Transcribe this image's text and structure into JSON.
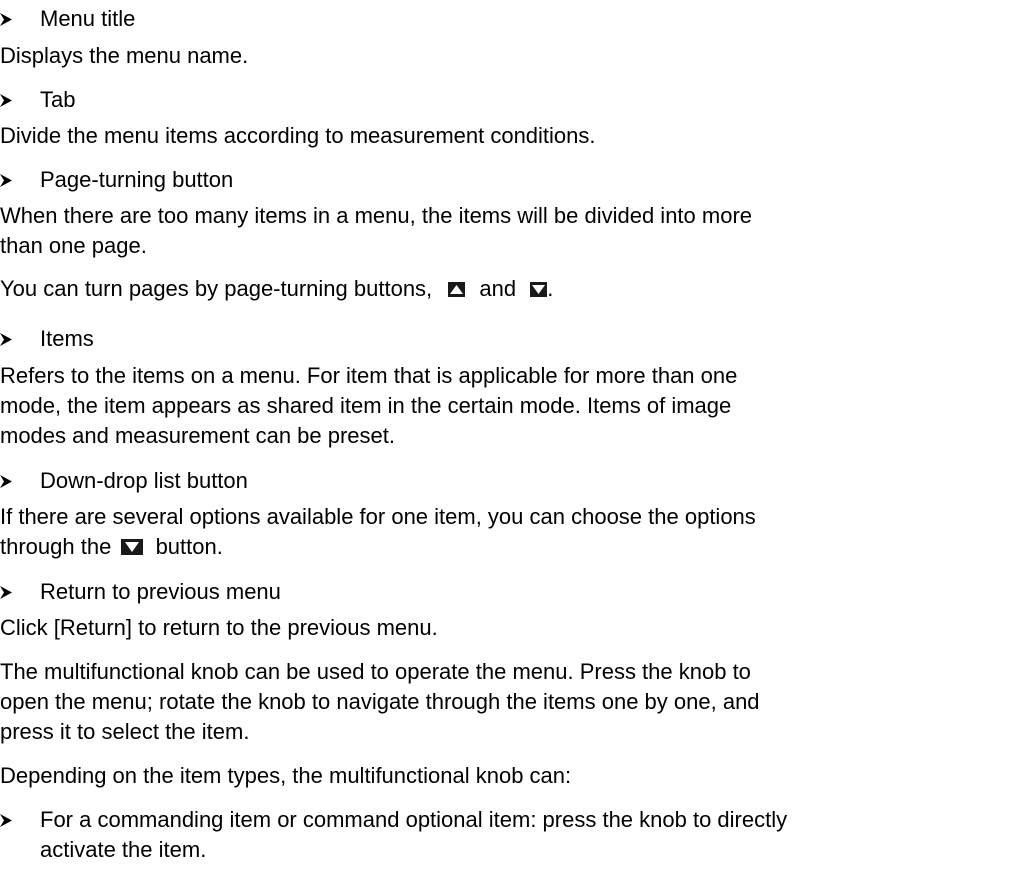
{
  "items": [
    {
      "kind": "bullet",
      "text": "Menu title"
    },
    {
      "kind": "para",
      "text": "Displays the menu name."
    },
    {
      "kind": "bullet",
      "text": "Tab"
    },
    {
      "kind": "para",
      "text": "Divide the menu items according to measurement conditions."
    },
    {
      "kind": "bullet",
      "text": "Page-turning button"
    },
    {
      "kind": "para",
      "text": "When there are too many items in a menu, the items will be divided into more"
    },
    {
      "kind": "para",
      "text": "than one page."
    },
    {
      "kind": "para_pageturn",
      "before": "You can turn pages by page-turning buttons,",
      "middle": "and",
      "after": "."
    },
    {
      "kind": "bullet",
      "text": "Items"
    },
    {
      "kind": "para",
      "text": "Refers to the items on a menu. For item that is applicable for more than one"
    },
    {
      "kind": "para",
      "text": "mode, the item appears as shared item in the certain mode. Items of image"
    },
    {
      "kind": "para",
      "text": "modes and measurement can be preset."
    },
    {
      "kind": "bullet",
      "text": "Down-drop list button"
    },
    {
      "kind": "para",
      "text": "If there are several options available for one item, you can choose the options"
    },
    {
      "kind": "para_drop",
      "before": "through the",
      "after": "button."
    },
    {
      "kind": "bullet",
      "text": "Return to previous menu"
    },
    {
      "kind": "para",
      "text": "Click [Return] to return to the previous menu."
    },
    {
      "kind": "para",
      "text": "The multifunctional knob can be used to operate the menu. Press the knob to"
    },
    {
      "kind": "para",
      "text": "open the menu; rotate the knob to navigate through the items one by one, and"
    },
    {
      "kind": "para",
      "text": "press it to select the item."
    },
    {
      "kind": "para",
      "text": "Depending on the item types, the multifunctional knob can:"
    },
    {
      "kind": "bullet",
      "text": "For a commanding item or command optional item: press the knob to directly"
    },
    {
      "kind": "para_indent",
      "text": "activate the item."
    }
  ],
  "icons": {
    "bullet": "right-arrowhead-icon",
    "page_up": "page-up-icon",
    "page_down": "page-down-icon",
    "dropdown": "dropdown-arrow-icon"
  }
}
